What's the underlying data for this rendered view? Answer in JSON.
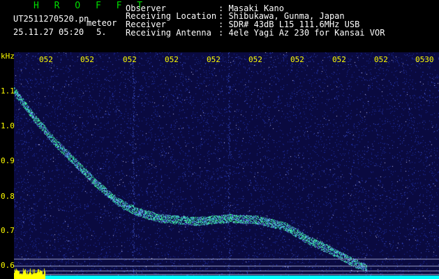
{
  "header": {
    "program": "H R O F F T",
    "filename": "UT2511270520.pn",
    "channel": "meteor",
    "timestamp": "25.11.27 05:20",
    "interval": "5.",
    "fields": [
      {
        "label": "Observer",
        "value": ": Masaki Kano"
      },
      {
        "label": "Receiving Location",
        "value": ": Shibukawa, Gunma, Japan"
      },
      {
        "label": "Receiver",
        "value": ": SDR# 43dB L15 111.6MHz USB"
      },
      {
        "label": "Receiving Antenna",
        "value": ": 4ele Yagi Az 230 for Kansai VOR"
      }
    ]
  },
  "colors": {
    "background": "#0a0a40",
    "header_text": "#ffffff",
    "program_text": "#00dd00",
    "axis_text": "#ffff00",
    "echo_trace": "#40ff90",
    "baseline": "#00ffff",
    "level_bar": "#ffff00"
  },
  "y_axis": {
    "unit": "kHz",
    "ticks": [
      "1.1",
      "1.0",
      "0.9",
      "0.8",
      "0.7",
      "0.6"
    ]
  },
  "x_axis": {
    "ticks": [
      "052",
      "052",
      "052",
      "052",
      "052",
      "052",
      "052",
      "052",
      "052",
      "0530"
    ]
  }
}
